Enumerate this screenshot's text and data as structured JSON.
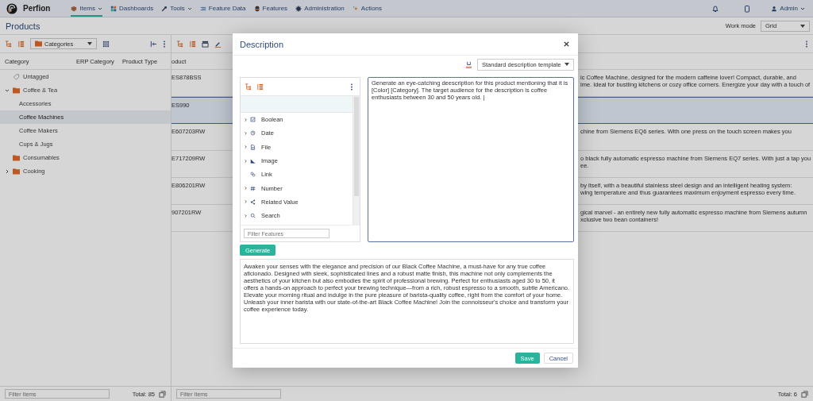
{
  "app": {
    "name": "Perfion",
    "user": "Admin"
  },
  "nav": [
    {
      "label": "Items",
      "kind": "items",
      "selected": true,
      "has_menu": true
    },
    {
      "label": "Dashboards",
      "kind": "dashboards",
      "selected": false,
      "has_menu": false
    },
    {
      "label": "Tools",
      "kind": "tools",
      "selected": false,
      "has_menu": true
    },
    {
      "label": "Feature Data",
      "kind": "featuredata",
      "selected": false,
      "has_menu": false
    },
    {
      "label": "Features",
      "kind": "features",
      "selected": false,
      "has_menu": false
    },
    {
      "label": "Administration",
      "kind": "administration",
      "selected": false,
      "has_menu": false
    },
    {
      "label": "Actions",
      "kind": "actions",
      "selected": false,
      "has_menu": false
    }
  ],
  "page": {
    "title": "Products",
    "work_mode_label": "Work mode",
    "work_mode": "Grid"
  },
  "categories": {
    "view": "Categories",
    "columns": [
      "Category",
      "ERP Category",
      "Product Type"
    ],
    "tree": [
      {
        "label": "Untagged",
        "kind": "tag",
        "selected": false
      },
      {
        "label": "Coffee & Tea",
        "kind": "folder",
        "selected": false,
        "expanded": true,
        "children": [
          {
            "label": "Accessories",
            "selected": false
          },
          {
            "label": "Coffee Machines",
            "selected": true
          },
          {
            "label": "Coffee Makers",
            "selected": false
          },
          {
            "label": "Cups & Jugs",
            "selected": false
          }
        ]
      },
      {
        "label": "Consumables",
        "kind": "folder",
        "selected": false
      },
      {
        "label": "Cooking",
        "kind": "folder",
        "selected": false,
        "expanded": false
      }
    ],
    "filter_placeholder": "Filter Items",
    "total": "Total: 85"
  },
  "grid": {
    "column_1": "oduct",
    "rows": [
      {
        "product": "ES878BSS",
        "description": [
          "ic Coffee Machine, designed for the modern caffeine lover! Compact, durable, and",
          "ime. Ideal for bustling kitchens or cozy office corners. Energize your day with a touch of"
        ],
        "selected": false
      },
      {
        "product": "ES990",
        "description": [],
        "selected": true
      },
      {
        "product": "E607203RW",
        "description": [
          "chine from Siemens EQ6 series. With one press on the touch screen makes you"
        ],
        "selected": false
      },
      {
        "product": "E717209RW",
        "description": [
          "o black fully automatic espresso machine from Siemens EQ7 series. With just a tap you",
          "ee."
        ],
        "selected": false
      },
      {
        "product": "E806201RW",
        "description": [
          "by itself, with a beautiful stainless steel design and an intelligent heating system:",
          "wing temperature and thus guarantees maximum enjoyment espresso every time."
        ],
        "selected": false
      },
      {
        "product": "907201RW",
        "description": [
          "gical marvel - an entirely new fully automatic espresso machine from Siemens autumn",
          "xclusive two bean containers!"
        ],
        "selected": false
      }
    ],
    "filter_placeholder": "Filter Items",
    "total": "Total: 6"
  },
  "dialog": {
    "title": "Description",
    "template": "Standard description template",
    "features": [
      {
        "label": "Boolean",
        "kind": "boolean",
        "expandable": true
      },
      {
        "label": "Date",
        "kind": "date",
        "expandable": true
      },
      {
        "label": "File",
        "kind": "file",
        "expandable": true
      },
      {
        "label": "Image",
        "kind": "image",
        "expandable": true
      },
      {
        "label": "Link",
        "kind": "link",
        "expandable": false
      },
      {
        "label": "Number",
        "kind": "number",
        "expandable": true
      },
      {
        "label": "Related Value",
        "kind": "related",
        "expandable": true
      },
      {
        "label": "Search",
        "kind": "search",
        "expandable": true
      }
    ],
    "filter_placeholder": "Filter Features",
    "prompt": "Generate an eye-catching deescription for this product mentioning that it is [Color] [Category]. The target audience for the description is coffee enthusiasts between 30 and 50 years old. |",
    "generate": "Generate",
    "output": "Awaken your senses with the elegance and precision of our Black Coffee Machine, a must-have for any true coffee aficionado. Designed with sleek, sophisticated lines and a robust matte finish, this machine not only complements the aesthetics of your kitchen but also embodies the spirit of professional brewing. Perfect for enthusiasts aged 30 to 50, it offers a hands-on approach to perfect your brewing technique—from a rich, robust espresso to a smooth, subtle Americano. Elevate your morning ritual and indulge in the pure pleasure of barista-quality coffee, right from the comfort of your home. Unleash your inner barista with our state-of-the-art Black Coffee Machine! Join the connoisseur's choice and transform your coffee experience today.",
    "save": "Save",
    "cancel": "Cancel"
  }
}
